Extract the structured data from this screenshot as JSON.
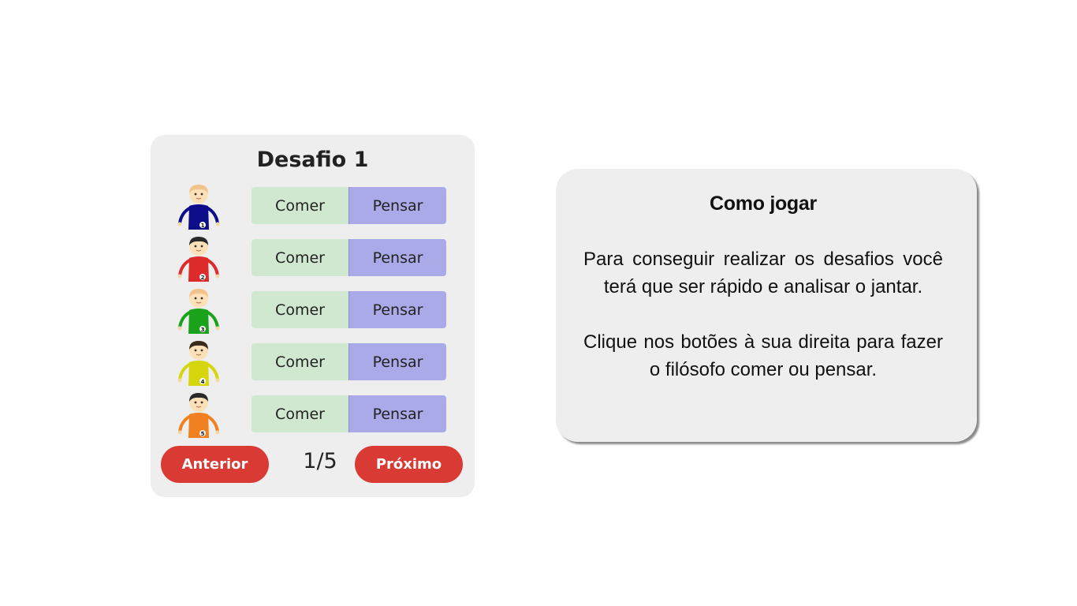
{
  "challenge": {
    "title": "Desafio 1",
    "philosophers": [
      {
        "number": "1",
        "shirt_color": "#0d0d8a",
        "hair_color": "#f2c28c",
        "eat_label": "Comer",
        "think_label": "Pensar"
      },
      {
        "number": "2",
        "shirt_color": "#dd2a2a",
        "hair_color": "#2a2a2a",
        "eat_label": "Comer",
        "think_label": "Pensar"
      },
      {
        "number": "3",
        "shirt_color": "#1aa31a",
        "hair_color": "#f2c28c",
        "eat_label": "Comer",
        "think_label": "Pensar"
      },
      {
        "number": "4",
        "shirt_color": "#d6d60e",
        "hair_color": "#3a2a1a",
        "eat_label": "Comer",
        "think_label": "Pensar"
      },
      {
        "number": "5",
        "shirt_color": "#f08020",
        "hair_color": "#2a2a2a",
        "eat_label": "Comer",
        "think_label": "Pensar"
      }
    ],
    "prev_label": "Anterior",
    "next_label": "Próximo",
    "counter": "1/5"
  },
  "howto": {
    "title": "Como jogar",
    "paragraphs": [
      "Para conseguir realizar os desafios você terá que ser rápido e analisar o jantar.",
      "Clique nos botões à sua direita para fazer o filósofo comer ou pensar."
    ]
  },
  "colors": {
    "panel_bg": "#eeeeee",
    "eat_bg": "#cfe8cf",
    "think_bg": "#aaaae8",
    "nav_button": "#d93a33"
  }
}
